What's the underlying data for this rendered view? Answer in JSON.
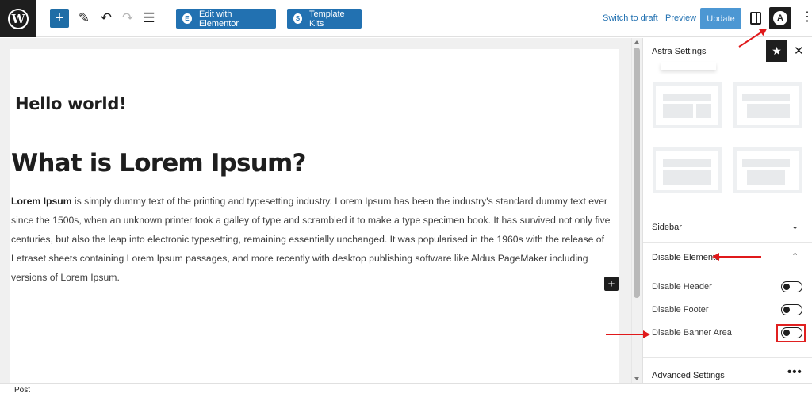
{
  "toolbar": {
    "add_label": "+",
    "edit_elementor_label": "Edit with Elementor",
    "template_kits_label": "Template Kits",
    "switch_draft_label": "Switch to draft",
    "preview_label": "Preview",
    "update_label": "Update"
  },
  "content": {
    "post_title": "Hello world!",
    "heading": "What is Lorem Ipsum?",
    "para_strong": "Lorem Ipsum",
    "para_text": " is simply dummy text of the printing and typesetting industry. Lorem Ipsum has been the industry's standard dummy text ever since the 1500s, when an unknown printer took a galley of type and scrambled it to make a type specimen book. It has survived not only five centuries, but also the leap into electronic typesetting, remaining essentially unchanged. It was popularised in the 1960s with the release of Letraset sheets containing Lorem Ipsum passages, and more recently with desktop publishing software like Aldus PageMaker including versions of Lorem Ipsum."
  },
  "sidebar": {
    "title": "Astra Settings",
    "sections": {
      "sidebar": "Sidebar",
      "disable_elements": "Disable Elements",
      "advanced": "Advanced Settings"
    },
    "toggles": {
      "header": {
        "label": "Disable Header",
        "on": false
      },
      "footer": {
        "label": "Disable Footer",
        "on": false
      },
      "banner": {
        "label": "Disable Banner Area",
        "on": false
      }
    }
  },
  "footer": {
    "label": "Post"
  },
  "colors": {
    "accent": "#2271b1",
    "annotation": "#e0191b",
    "dark": "#1e1e1e"
  },
  "icons": [
    "wordpress-icon",
    "plus-icon",
    "pencil-icon",
    "undo-icon",
    "redo-icon",
    "list-view-icon",
    "elementor-icon",
    "template-kits-icon",
    "sidebar-toggle-icon",
    "astra-icon",
    "kebab-icon",
    "star-icon",
    "close-icon",
    "chevron-down-icon",
    "chevron-up-icon",
    "more-dots-icon"
  ]
}
